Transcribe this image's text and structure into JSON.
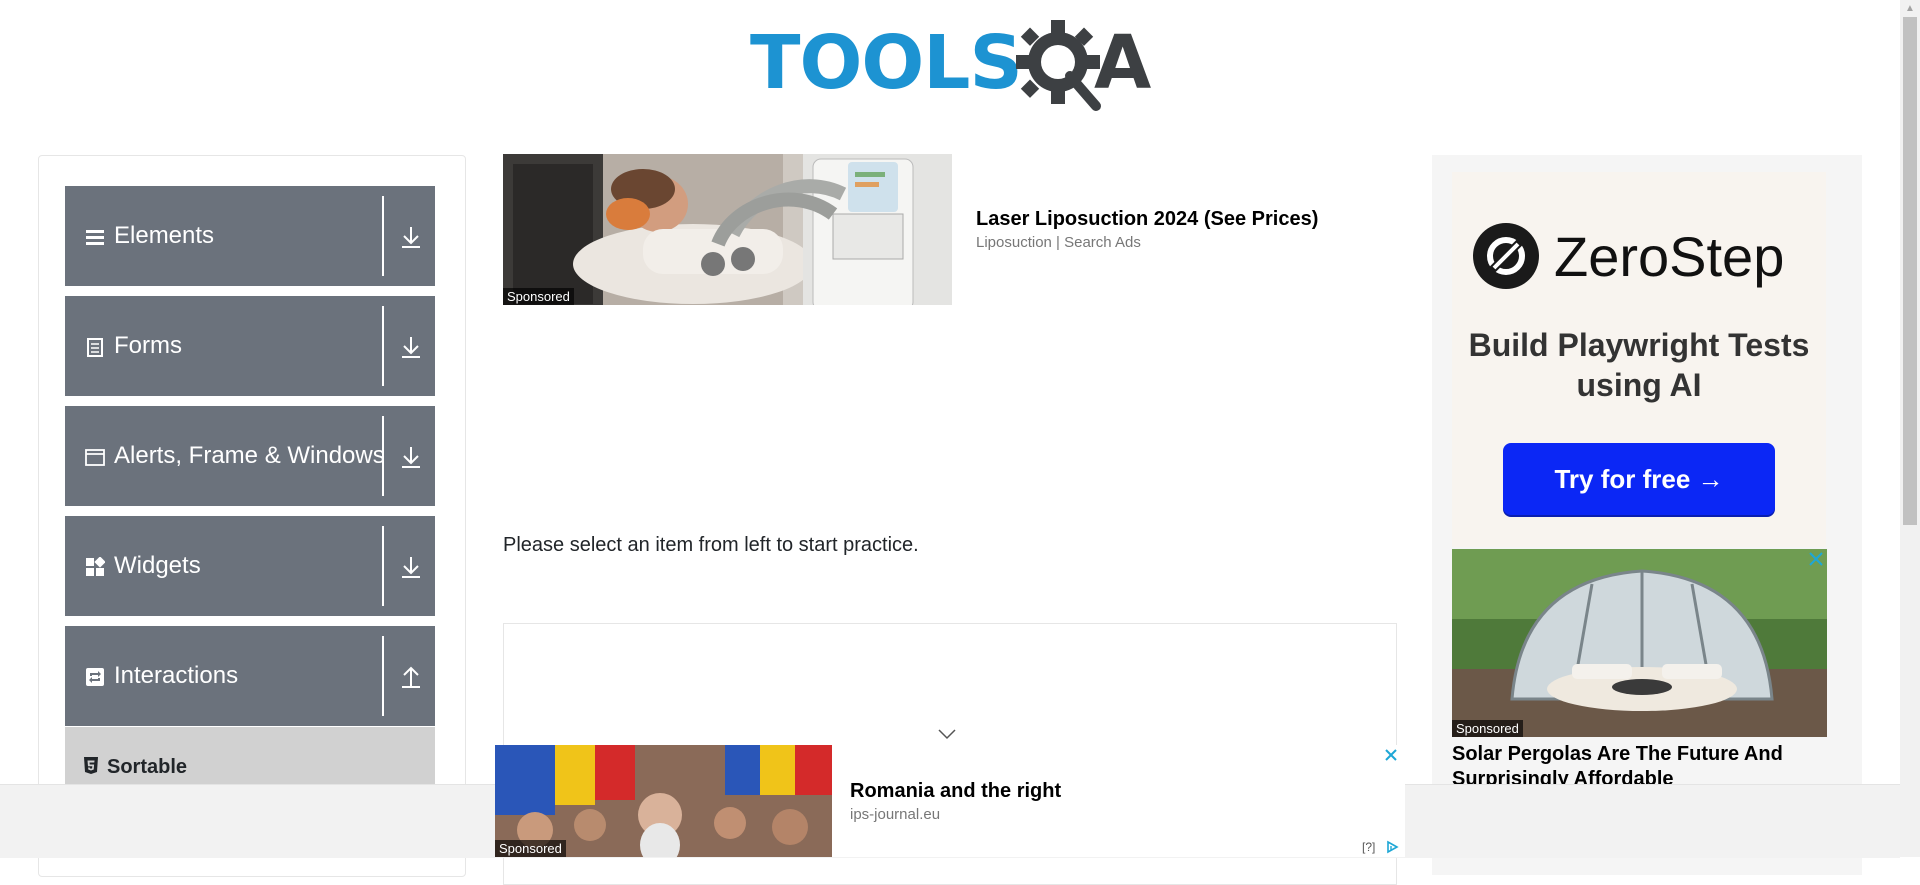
{
  "header": {
    "logo_text_main": "TOOLS",
    "logo_text_end": "A"
  },
  "colors": {
    "logo_blue": "#1d93d2",
    "logo_gray": "#3d4043",
    "nav_group_bg": "#6b727c",
    "nav_subitem_bg": "#d1d1d1",
    "cta_blue": "#0b27f5"
  },
  "nav": {
    "groups": [
      {
        "label": "Elements",
        "icon": "hamburger-icon",
        "toggle": "download-icon",
        "expanded": false
      },
      {
        "label": "Forms",
        "icon": "document-icon",
        "toggle": "download-icon",
        "expanded": false
      },
      {
        "label": "Alerts, Frame & Windows",
        "icon": "window-icon",
        "toggle": "download-icon",
        "expanded": false
      },
      {
        "label": "Widgets",
        "icon": "widgets-grid-icon",
        "toggle": "download-icon",
        "expanded": false
      },
      {
        "label": "Interactions",
        "icon": "interactions-icon",
        "toggle": "upload-icon",
        "expanded": true
      }
    ],
    "sub_items": [
      {
        "label": "Sortable",
        "icon": "html5-icon"
      }
    ]
  },
  "main": {
    "ad_top": {
      "title": "Laser Liposuction 2024 (See Prices)",
      "source": "Liposuction | Search Ads",
      "sponsored": "Sponsored"
    },
    "practice_text": "Please select an item from left to start practice."
  },
  "right_ads": {
    "zerostep": {
      "brand": "ZeroStep",
      "headline": "Build Playwright Tests using AI",
      "cta": "Try for free →"
    },
    "pergola": {
      "sponsored": "Sponsored",
      "title": "Solar Pergolas Are The Future And Surprisingly Affordable"
    }
  },
  "sticky_ad": {
    "title": "Romania and the right",
    "source": "ips-journal.eu",
    "sponsored": "Sponsored",
    "adchoices_label": "[?]"
  }
}
